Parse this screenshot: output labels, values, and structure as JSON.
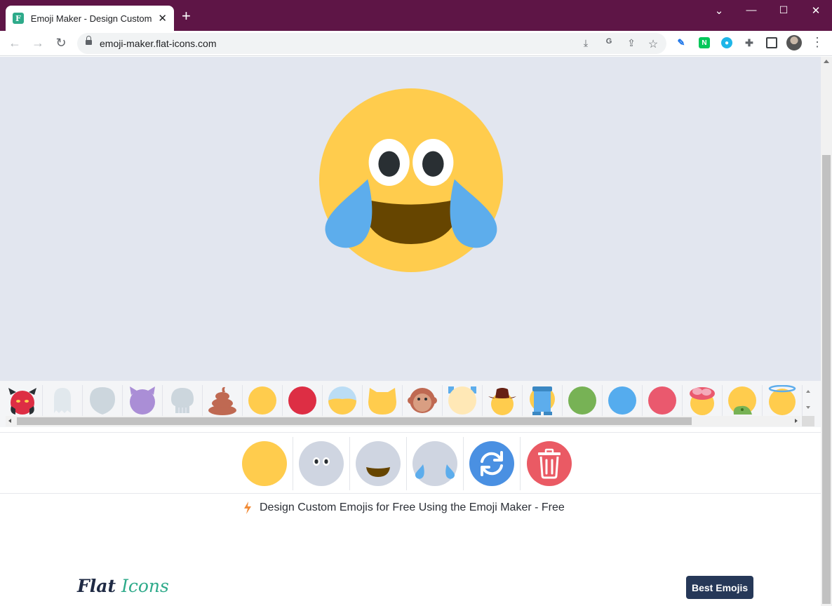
{
  "browser": {
    "tab_title": "Emoji Maker - Design Custom E",
    "tab_favicon_letter": "F",
    "url": "emoji-maker.flat-icons.com",
    "new_tab_icon": "plus-icon",
    "window_controls": [
      "chevron-down-icon",
      "minimize-icon",
      "maximize-icon",
      "close-icon"
    ],
    "extensions": [
      "download-icon",
      "translate-icon",
      "share-icon",
      "star-icon",
      "extension-pen-icon",
      "naver-icon",
      "chat-icon",
      "puzzle-icon",
      "sidebar-icon"
    ],
    "naver_letter": "N"
  },
  "canvas": {
    "background_color": "#e2e6ef",
    "emoji_name": "face-with-tears-of-joy"
  },
  "palette": {
    "items": [
      "devil",
      "ghost",
      "alien",
      "purple-devil",
      "skull",
      "poop",
      "yellow-face",
      "red-face",
      "bowl-face",
      "cat-face",
      "monkey-face",
      "pale-face",
      "cowboy-face",
      "bucket-head",
      "green-face",
      "blue-face",
      "pink-face",
      "brain-face",
      "zombie-face",
      "angel-face"
    ]
  },
  "layers": {
    "items": [
      "base-layer",
      "eyes-layer",
      "mouth-layer",
      "tears-layer"
    ],
    "refresh_icon": "refresh-icon",
    "delete_icon": "trash-icon"
  },
  "tagline": {
    "icon": "lightning-icon",
    "text": "Design Custom Emojis for Free Using the Emoji Maker - Free"
  },
  "footer": {
    "brand_part1": "Flat",
    "brand_part2": "Icons",
    "best_button": "Best Emojis"
  },
  "colors": {
    "titlebar": "#5e1546",
    "face_yellow": "#ffcc4d",
    "mouth_brown": "#664500",
    "tear_blue": "#5dadec",
    "refresh_blue": "#4a90e2",
    "delete_red": "#ea5a64",
    "button_navy": "#263858",
    "brand_green": "#2eaa8a"
  }
}
